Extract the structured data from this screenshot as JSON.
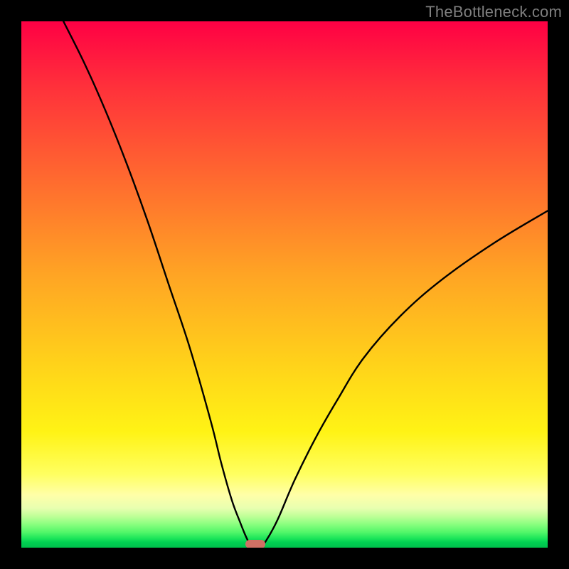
{
  "watermark": "TheBottleneck.com",
  "marker": {
    "x_pct": 44.5,
    "y_pct": 99.3
  },
  "chart_data": {
    "type": "line",
    "title": "",
    "xlabel": "",
    "ylabel": "",
    "xlim": [
      0,
      100
    ],
    "ylim": [
      0,
      100
    ],
    "grid": false,
    "note": "Axes are unlabeled; values are percentages of the plotting area. y=100 is the top edge, y=0 is the bottom (green) edge.",
    "series": [
      {
        "name": "left-branch",
        "x": [
          8.0,
          12.0,
          16.0,
          20.0,
          24.0,
          28.0,
          32.0,
          36.0,
          38.0,
          40.0,
          41.5,
          42.5,
          43.2
        ],
        "y": [
          100.0,
          92.0,
          83.0,
          73.0,
          62.0,
          50.0,
          38.0,
          24.0,
          16.0,
          9.0,
          5.0,
          2.5,
          1.0
        ]
      },
      {
        "name": "right-branch",
        "x": [
          46.3,
          47.5,
          49.0,
          52.0,
          56.0,
          60.0,
          65.0,
          72.0,
          80.0,
          90.0,
          100.0
        ],
        "y": [
          1.0,
          3.0,
          6.0,
          13.0,
          21.0,
          28.0,
          36.0,
          44.0,
          51.0,
          58.0,
          64.0
        ]
      }
    ],
    "annotations": [
      {
        "name": "trough-marker",
        "x": 44.5,
        "y": 0.7,
        "color": "#d17064"
      }
    ],
    "background_gradient": {
      "direction": "top-to-bottom",
      "stops": [
        {
          "pct": 0,
          "color": "#ff0044"
        },
        {
          "pct": 30,
          "color": "#ff6a2f"
        },
        {
          "pct": 65,
          "color": "#ffd21a"
        },
        {
          "pct": 90,
          "color": "#ffffa8"
        },
        {
          "pct": 97,
          "color": "#55f76a"
        },
        {
          "pct": 100,
          "color": "#00c04c"
        }
      ]
    }
  }
}
